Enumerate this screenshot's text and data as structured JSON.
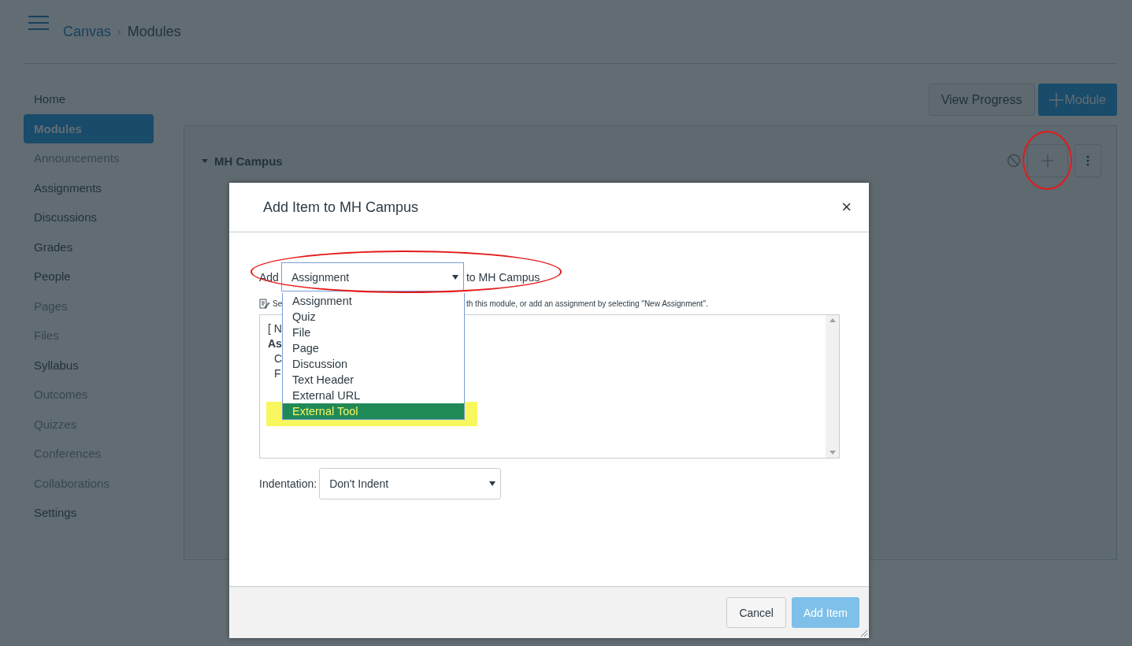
{
  "breadcrumb": {
    "root": "Canvas",
    "separator": "›",
    "current": "Modules"
  },
  "sidebar": {
    "items": [
      {
        "label": "Home",
        "selected": false,
        "disabled": false
      },
      {
        "label": "Modules",
        "selected": true,
        "disabled": false
      },
      {
        "label": "Announcements",
        "selected": false,
        "disabled": true
      },
      {
        "label": "Assignments",
        "selected": false,
        "disabled": false
      },
      {
        "label": "Discussions",
        "selected": false,
        "disabled": false
      },
      {
        "label": "Grades",
        "selected": false,
        "disabled": false
      },
      {
        "label": "People",
        "selected": false,
        "disabled": false
      },
      {
        "label": "Pages",
        "selected": false,
        "disabled": true
      },
      {
        "label": "Files",
        "selected": false,
        "disabled": true
      },
      {
        "label": "Syllabus",
        "selected": false,
        "disabled": false
      },
      {
        "label": "Outcomes",
        "selected": false,
        "disabled": true
      },
      {
        "label": "Quizzes",
        "selected": false,
        "disabled": true
      },
      {
        "label": "Conferences",
        "selected": false,
        "disabled": true
      },
      {
        "label": "Collaborations",
        "selected": false,
        "disabled": true
      },
      {
        "label": "Settings",
        "selected": false,
        "disabled": false
      }
    ]
  },
  "toolbar": {
    "view_progress": "View Progress",
    "add_module": "Module"
  },
  "module": {
    "name": "MH Campus",
    "expanded": true
  },
  "dialog": {
    "title": "Add Item to MH Campus",
    "close": "×",
    "add_label": "Add",
    "type_select": {
      "value": "Assignment",
      "open": true
    },
    "target_label": "to MH Campus",
    "hint_start": "Se",
    "hint_end": "th this module, or add an assignment by selecting \"New Assignment\".",
    "list_lines": [
      {
        "text": "[ N",
        "kind": "plain"
      },
      {
        "text": "As",
        "kind": "bold"
      },
      {
        "text": "C",
        "kind": "indented"
      },
      {
        "text": "F",
        "kind": "indented"
      }
    ],
    "type_options": [
      {
        "label": "Assignment",
        "selected": false
      },
      {
        "label": "Quiz",
        "selected": false
      },
      {
        "label": "File",
        "selected": false
      },
      {
        "label": "Page",
        "selected": false
      },
      {
        "label": "Discussion",
        "selected": false
      },
      {
        "label": "Text Header",
        "selected": false
      },
      {
        "label": "External URL",
        "selected": false
      },
      {
        "label": "External Tool",
        "selected": true
      }
    ],
    "indentation_label": "Indentation:",
    "indentation_value": "Don't Indent",
    "cancel": "Cancel",
    "submit": "Add Item"
  }
}
